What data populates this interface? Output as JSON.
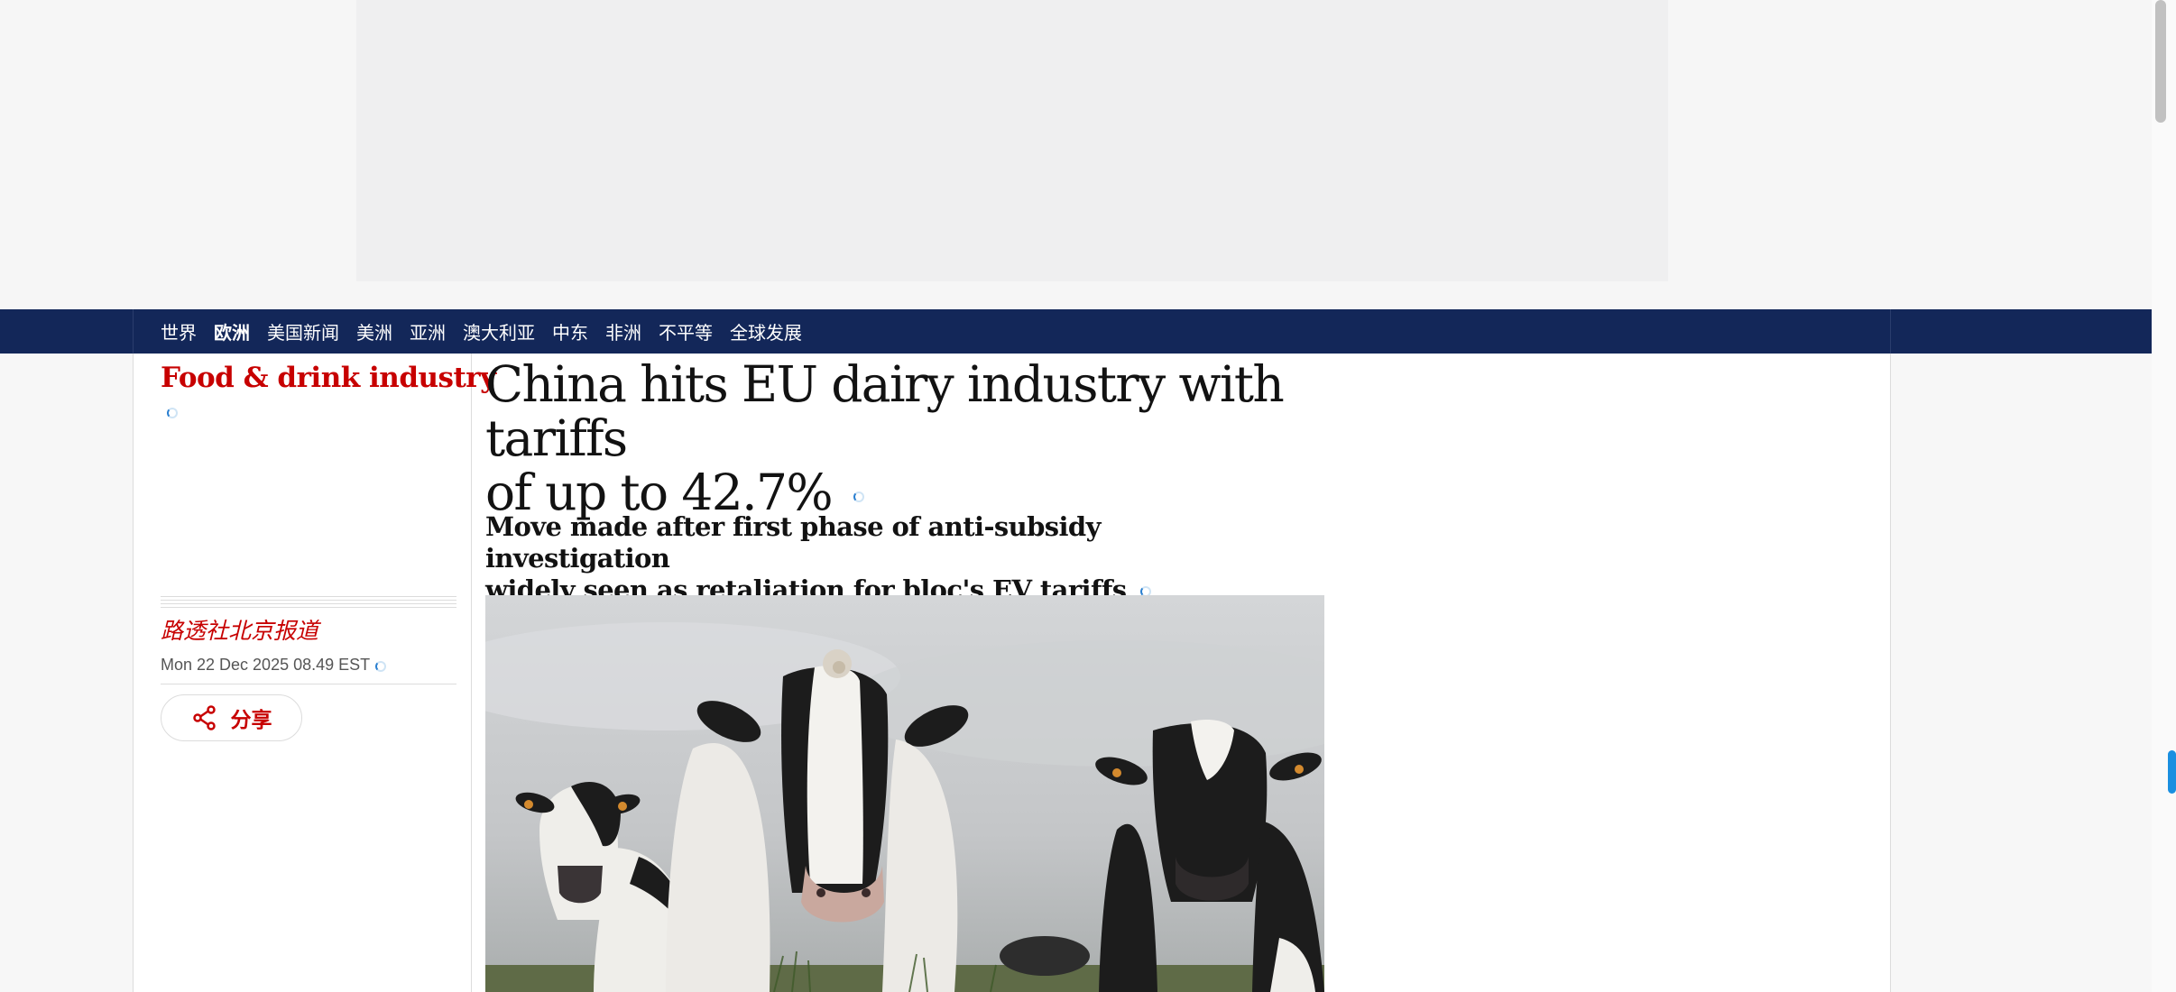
{
  "nav": {
    "items": [
      "世界",
      "欧洲",
      "美国新闻",
      "美洲",
      "亚洲",
      "澳大利亚",
      "中东",
      "非洲",
      "不平等",
      "全球发展"
    ],
    "active": "欧洲"
  },
  "article": {
    "section": "Food & drink industry",
    "headline_line1": "China hits EU dairy industry with tariffs",
    "headline_line2": "of up to 42.7%",
    "standfirst_line1": "Move made after first phase of anti-subsidy investigation",
    "standfirst_line2": "widely seen as retaliation for bloc's EV tariffs",
    "byline": "路透社北京报道",
    "dateline": "Mon 22 Dec 2025 08.49 EST",
    "share_label": "分享",
    "image_alt": "cows-in-field"
  },
  "colors": {
    "nav_bg": "#132759",
    "accent": "#c70000",
    "text": "#121212"
  }
}
